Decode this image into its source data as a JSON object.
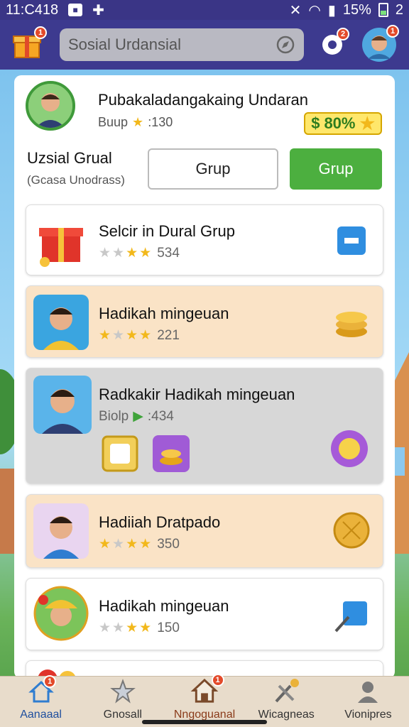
{
  "status_bar": {
    "time": "11:C418",
    "battery_percent": "15%",
    "extra": "2"
  },
  "header": {
    "search_placeholder": "Sosial Urdansial",
    "gift_badge": "1",
    "settings_badge": "2",
    "avatar_badge": "1"
  },
  "profile": {
    "name": "Pubakaladangakaing Undaran",
    "sub_label": "Buup",
    "sub_value": ":130",
    "percent": "80%",
    "group_title": "Uzsial Grual",
    "group_subtitle": "(Gcasa Unodrass)",
    "btn_outline": "Grup",
    "btn_primary": "Grup"
  },
  "cards": [
    {
      "title": "Selcir in Dural Grup",
      "stars": [
        0,
        0,
        1,
        1
      ],
      "value": "534",
      "bg": "#ffffff"
    },
    {
      "title": "Hadikah mingeuan",
      "stars": [
        1,
        0,
        1,
        1
      ],
      "value": "221",
      "bg": "#fae3c6"
    },
    {
      "title": "Radkakir Hadikah mingeuan",
      "meta_label": "Biolp",
      "value": ":434",
      "bg": "#d7d7d7"
    },
    {
      "title": "Hadiiah Dratpado",
      "stars": [
        1,
        0,
        1,
        1
      ],
      "value": "350",
      "bg": "#fae3c6"
    },
    {
      "title": "Hadikah mingeuan",
      "stars": [
        0,
        0,
        1,
        1
      ],
      "value": "150",
      "bg": "#ffffff"
    }
  ],
  "bottom_nav": [
    {
      "label": "Aanaaal",
      "icon": "home-icon",
      "badge": "1"
    },
    {
      "label": "Gnosall",
      "icon": "star-icon"
    },
    {
      "label": "Nngoguanal",
      "icon": "house-icon",
      "badge": "1"
    },
    {
      "label": "Wicagneas",
      "icon": "tools-icon"
    },
    {
      "label": "Vionipres",
      "icon": "person-icon"
    }
  ],
  "colors": {
    "header_bg": "#3d3a8f",
    "accent_green": "#4caf3f",
    "badge_red": "#e34a2a"
  }
}
